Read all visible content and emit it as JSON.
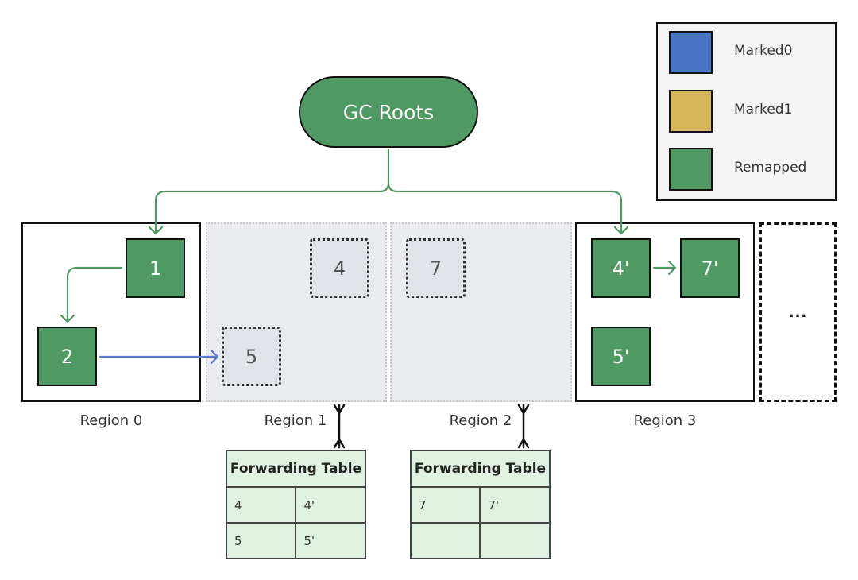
{
  "colors": {
    "marked0": "#4a74c4",
    "marked1": "#d6b659",
    "remapped": "#4f9a62",
    "stale_object": "#e0e3e8",
    "freed_region": "#e9ebee",
    "forwarding_table_bg": "#dff2e1",
    "green_ref": "#4f9a62",
    "blue_ref": "#5a7dc9"
  },
  "root": {
    "label": "GC Roots"
  },
  "legend": {
    "items": [
      {
        "label": "Marked0",
        "color": "#4a74c4"
      },
      {
        "label": "Marked1",
        "color": "#d6b659"
      },
      {
        "label": "Remapped",
        "color": "#4f9a62"
      }
    ]
  },
  "regions": [
    {
      "label": "Region 0",
      "state": "active",
      "objects": [
        {
          "label": "1",
          "state": "remapped"
        },
        {
          "label": "2",
          "state": "remapped"
        }
      ]
    },
    {
      "label": "Region 1",
      "state": "relocated",
      "objects": [
        {
          "label": "4",
          "state": "stale"
        },
        {
          "label": "5",
          "state": "stale"
        }
      ]
    },
    {
      "label": "Region 2",
      "state": "relocated",
      "objects": [
        {
          "label": "7",
          "state": "stale"
        }
      ]
    },
    {
      "label": "Region 3",
      "state": "active",
      "objects": [
        {
          "label": "4'",
          "state": "remapped"
        },
        {
          "label": "7'",
          "state": "remapped"
        },
        {
          "label": "5'",
          "state": "remapped"
        }
      ]
    },
    {
      "label": "...",
      "state": "more"
    }
  ],
  "references": [
    {
      "from": "GC Roots",
      "to": "1",
      "color": "green"
    },
    {
      "from": "GC Roots",
      "to": "4'",
      "color": "green"
    },
    {
      "from": "1",
      "to": "2",
      "color": "green"
    },
    {
      "from": "2",
      "to": "5",
      "color": "blue"
    },
    {
      "from": "4'",
      "to": "7'",
      "color": "green"
    }
  ],
  "forwarding_tables": [
    {
      "region": "Region 1",
      "title": "Forwarding Table",
      "rows": [
        [
          "4",
          "4'"
        ],
        [
          "5",
          "5'"
        ]
      ]
    },
    {
      "region": "Region 2",
      "title": "Forwarding Table",
      "rows": [
        [
          "7",
          "7'"
        ],
        [
          "",
          ""
        ]
      ]
    }
  ]
}
